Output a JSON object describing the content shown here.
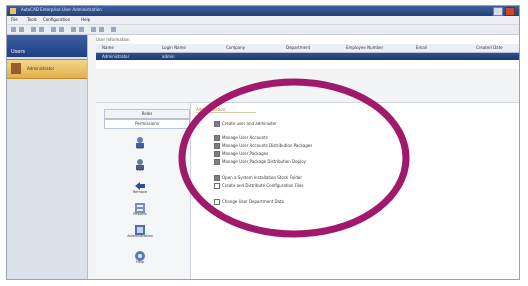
{
  "window": {
    "title": "AutoCAD Enterprise User Administration"
  },
  "menu": [
    "File",
    "Tools",
    "Configuration",
    "Help"
  ],
  "nav": {
    "header": "Users",
    "selected_user": "Administrator"
  },
  "grid": {
    "title": "User Information",
    "columns": [
      "Name",
      "Login Name",
      "Company",
      "Department",
      "Employee Number",
      "Email",
      "Created Date"
    ],
    "row": [
      "Administrator",
      "admin",
      "",
      "",
      "",
      "",
      ""
    ]
  },
  "tabs": [
    "Roles",
    "Permissions"
  ],
  "tools": [
    "Add",
    "Edit",
    "Remove",
    "Reports",
    "Administration",
    "Help"
  ],
  "permissions": {
    "title": "Administration",
    "items": [
      {
        "label": "Create user and administer",
        "checked": true
      },
      {
        "label": "Manage User Accounts",
        "checked": true
      },
      {
        "label": "Manage User Accounts Distribution Packages",
        "checked": true
      },
      {
        "label": "Manage User Packages",
        "checked": true
      },
      {
        "label": "Manage User Package Distribution Deploy",
        "checked": true
      },
      {
        "label": "Open a System Installation Stock Folder",
        "checked": true
      },
      {
        "label": "Create and Distribute Configuration Files",
        "checked": false
      },
      {
        "label": "Change User Department Data",
        "checked": false
      }
    ]
  },
  "annotation": {
    "color": "#a0196b"
  },
  "colors": {
    "titlebar": "#2f4f8f",
    "selected": "#e8b858",
    "annotation": "#a0196b"
  }
}
